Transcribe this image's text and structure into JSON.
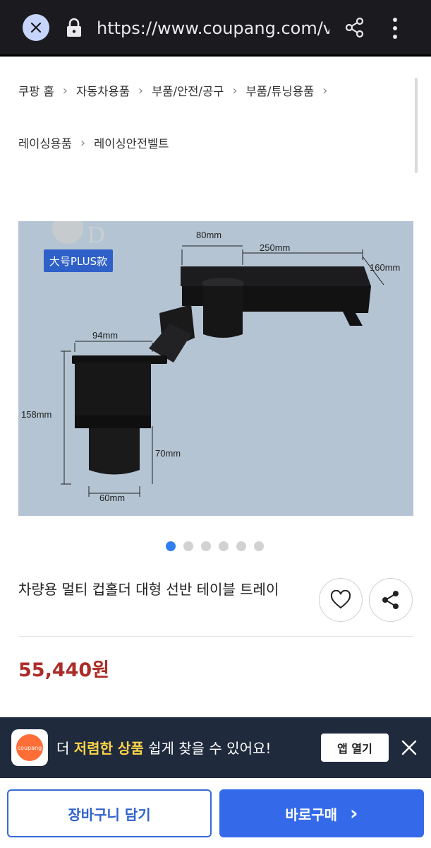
{
  "browser": {
    "url": "https://www.coupang.com/v"
  },
  "breadcrumb": {
    "row1": [
      "쿠팡 홈",
      "자동차용품",
      "부품/안전/공구",
      "부품/튜닝용품"
    ],
    "row2": [
      "레이싱용품",
      "레이싱안전벨트"
    ]
  },
  "product_image": {
    "badge": "大号PLUS款",
    "dimensions": {
      "d80": "80mm",
      "d250": "250mm",
      "d160": "160mm",
      "d94": "94mm",
      "d158": "158mm",
      "d70": "70mm",
      "d60": "60mm"
    },
    "watermark_letter": "D"
  },
  "carousel": {
    "total": 6,
    "active_index": 0
  },
  "product": {
    "title": "차량용 멀티 컵홀더 대형 선반 테이블 트레이",
    "price": "55,440원"
  },
  "app_banner": {
    "logo_text": "coupang",
    "text_pre": "더 ",
    "text_highlight": "저렴한 상품",
    "text_post": " 쉽게 찾을 수 있어요!",
    "open_button": "앱 열기"
  },
  "bottom": {
    "cart_button": "장바구니 담기",
    "buy_button": "바로구매",
    "buy_arrow": "›"
  },
  "colors": {
    "accent_blue": "#346aea",
    "price_red": "#ad2c28",
    "banner_bg": "#1f2a3d",
    "highlight": "#ffd54a"
  }
}
